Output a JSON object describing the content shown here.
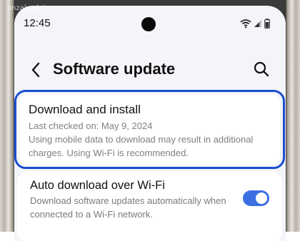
{
  "watermark": "anzalweb.ir",
  "status_bar": {
    "time": "12:45",
    "icons": [
      "wifi-icon",
      "signal-icon",
      "battery-icon"
    ]
  },
  "header": {
    "back_icon": "chevron-left-icon",
    "title": "Software update",
    "search_icon": "search-icon"
  },
  "download_install": {
    "title": "Download and install",
    "last_checked": "Last checked on: May 9, 2024",
    "note": "Using mobile data to download may result in additional charges. Using Wi-Fi is recommended."
  },
  "auto_download": {
    "title": "Auto download over Wi-Fi",
    "description": "Download software updates automatically when connected to a Wi-Fi network.",
    "enabled": true
  },
  "colors": {
    "accent": "#3b6fe2",
    "highlight_border": "#1b4fd1",
    "background": "#f4f5f9",
    "secondary_text": "#808080"
  }
}
